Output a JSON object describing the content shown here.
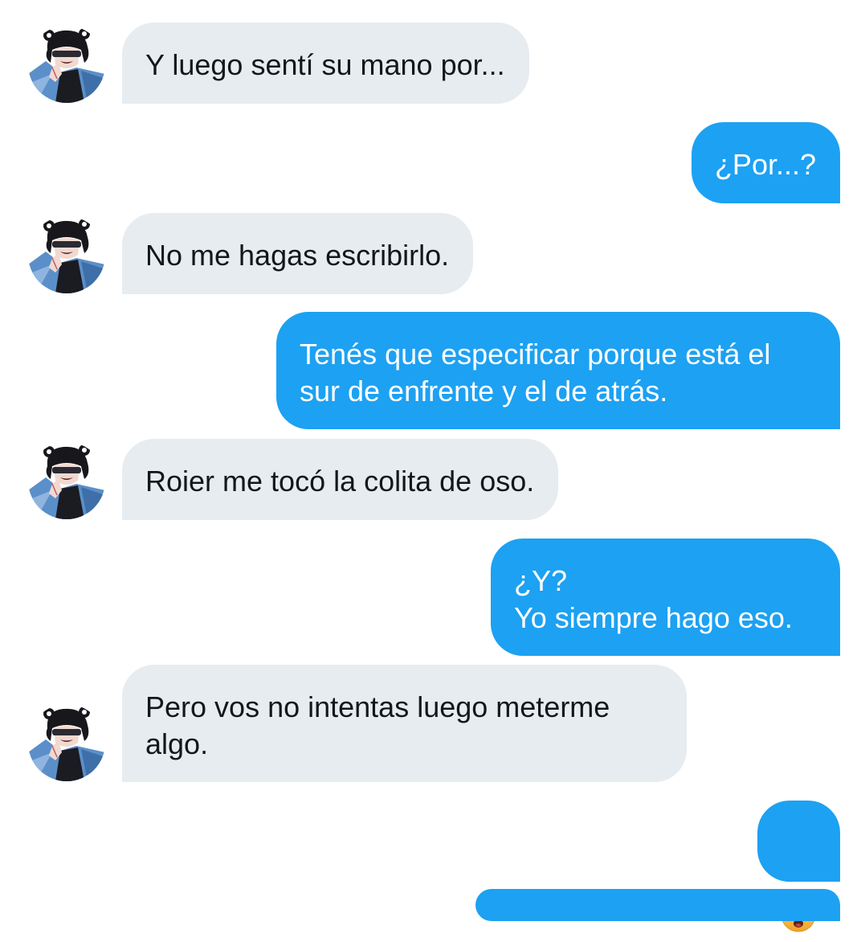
{
  "conversation": {
    "messages": [
      {
        "side": "in",
        "text": "Y luego sentí su mano por..."
      },
      {
        "side": "out",
        "text": "¿Por...?"
      },
      {
        "side": "in",
        "text": "No me hagas escribirlo."
      },
      {
        "side": "out",
        "text": "Tenés que especificar porque está el\nsur de enfrente y el de atrás."
      },
      {
        "side": "in",
        "text": "Roier me tocó la colita de oso."
      },
      {
        "side": "out",
        "text": "¿Y?\nYo siempre hago eso."
      },
      {
        "side": "in",
        "text": "Pero vos no intentas luego meterme\nalgo."
      },
      {
        "side": "out",
        "text": "😨",
        "emoji_icon": "fearful-face-icon"
      }
    ]
  },
  "colors": {
    "incoming_bubble": "#e6ecf0",
    "outgoing_bubble": "#1da1f2",
    "incoming_text": "#14171a",
    "outgoing_text": "#ffffff"
  }
}
